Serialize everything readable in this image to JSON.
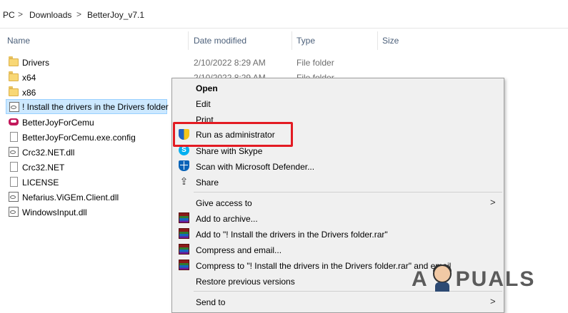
{
  "breadcrumb": {
    "seg1": "PC",
    "seg2": "Downloads",
    "seg3": "BetterJoy_v7.1",
    "sep": ">"
  },
  "columns": {
    "name": "Name",
    "date": "Date modified",
    "type": "Type",
    "size": "Size"
  },
  "files": [
    {
      "name": "Drivers",
      "date": "2/10/2022 8:29 AM",
      "type": "File folder"
    },
    {
      "name": "x64",
      "date": "2/10/2022 8:29 AM",
      "type": "File folder"
    },
    {
      "name": "x86"
    },
    {
      "name": "! Install the drivers in the Drivers folder"
    },
    {
      "name": "BetterJoyForCemu"
    },
    {
      "name": "BetterJoyForCemu.exe.config"
    },
    {
      "name": "Crc32.NET.dll"
    },
    {
      "name": "Crc32.NET"
    },
    {
      "name": "LICENSE"
    },
    {
      "name": "Nefarius.ViGEm.Client.dll"
    },
    {
      "name": "WindowsInput.dll"
    }
  ],
  "context_menu": {
    "open": "Open",
    "edit": "Edit",
    "print": "Print",
    "run_as_admin": "Run as administrator",
    "share_skype": "Share with Skype",
    "scan_defender": "Scan with Microsoft Defender...",
    "share": "Share",
    "give_access": "Give access to",
    "add_archive": "Add to archive...",
    "add_rar": "Add to \"! Install the drivers in the Drivers folder.rar\"",
    "compress_email": "Compress and email...",
    "compress_rar_email": "Compress to \"! Install the drivers in the Drivers folder.rar\" and email",
    "restore": "Restore previous versions",
    "send_to": "Send to",
    "submenu_arrow": ">"
  },
  "watermark": {
    "left": "A",
    "right": "PUALS"
  },
  "colors": {
    "highlight": "#e31b23",
    "selection": "#cce8ff",
    "header_text": "#4c607a"
  }
}
